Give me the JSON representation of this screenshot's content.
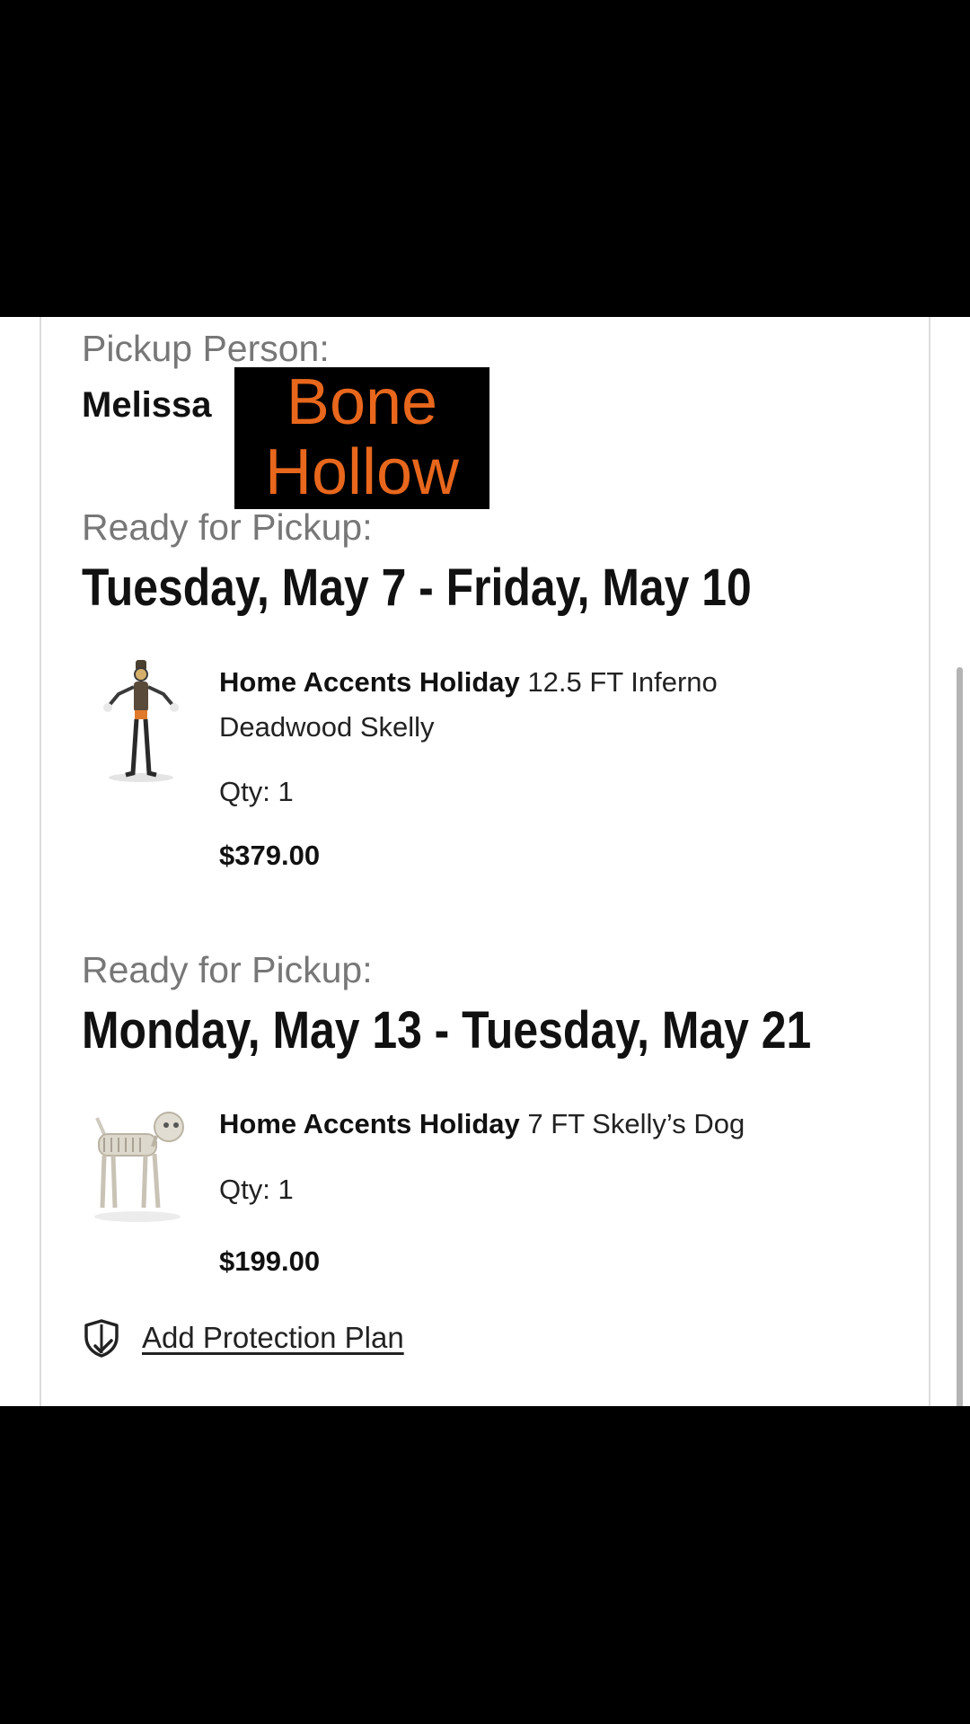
{
  "pickup_person": {
    "label": "Pickup Person:",
    "name": "Melissa",
    "redaction_line1": "Bone",
    "redaction_line2": "Hollow"
  },
  "colors": {
    "redaction_text": "#e8671c"
  },
  "shipments": [
    {
      "ready_label": "Ready for Pickup:",
      "date_range": "Tuesday, May 7 - Friday, May 10",
      "item": {
        "brand": "Home Accents Holiday",
        "name": "12.5 FT Inferno Deadwood Skelly",
        "qty": "Qty: 1",
        "price": "$379.00",
        "image": "skeleton-figure-icon"
      }
    },
    {
      "ready_label": "Ready for Pickup:",
      "date_range": "Monday, May 13 - Tuesday, May 21",
      "item": {
        "brand": "Home Accents Holiday",
        "name": "7 FT Skelly’s Dog",
        "qty": "Qty: 1",
        "price": "$199.00",
        "image": "skeleton-dog-icon"
      }
    }
  ],
  "protection": {
    "label": "Add Protection Plan",
    "icon": "shield-check-icon"
  }
}
